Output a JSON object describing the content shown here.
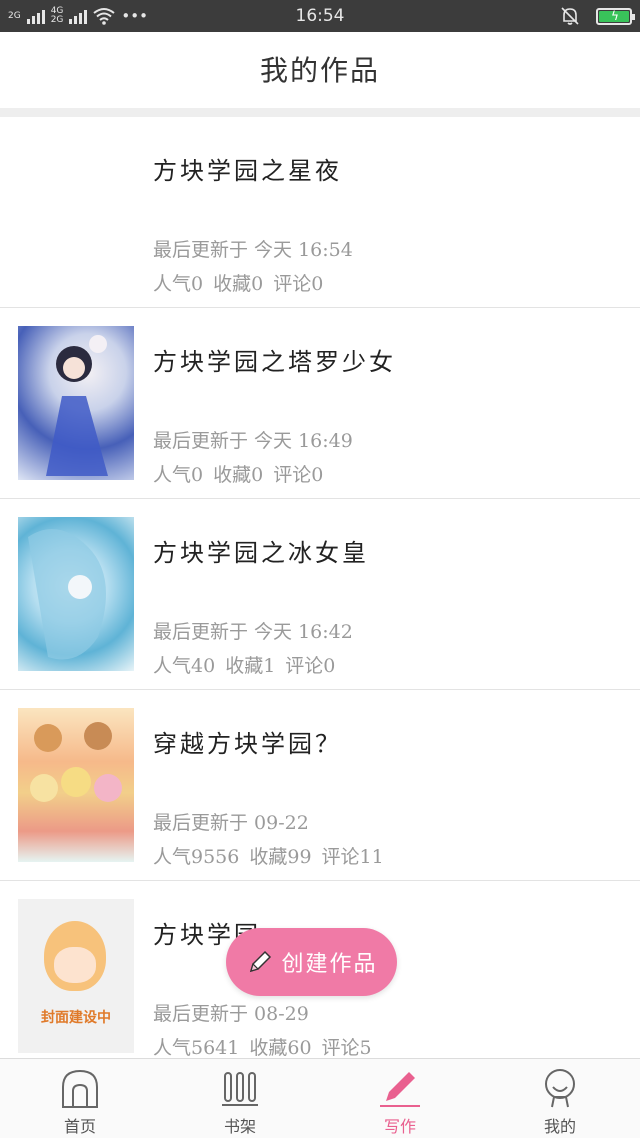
{
  "status_bar": {
    "left": [
      "2G",
      "4G",
      "2G",
      "•••"
    ],
    "time": "16:54",
    "icons": [
      "signal-icon",
      "wifi-icon",
      "bell-muted-icon",
      "battery-charging-icon"
    ]
  },
  "header": {
    "title": "我的作品"
  },
  "works": [
    {
      "title": "方块学园之星夜",
      "updated": "最后更新于 今天 16:54",
      "popularity": "人气0",
      "favorites": "收藏0",
      "comments": "评论0",
      "cover": "none"
    },
    {
      "title": "方块学园之塔罗少女",
      "updated": "最后更新于 今天 16:49",
      "popularity": "人气0",
      "favorites": "收藏0",
      "comments": "评论0",
      "cover": "anime-girl-blue-dress"
    },
    {
      "title": "方块学园之冰女皇",
      "updated": "最后更新于 今天 16:42",
      "popularity": "人气40",
      "favorites": "收藏1",
      "comments": "评论0",
      "cover": "anime-girl-ice"
    },
    {
      "title": "穿越方块学园？",
      "updated": "最后更新于 09-22",
      "popularity": "人气9556",
      "favorites": "收藏99",
      "comments": "评论11",
      "cover": "anime-group"
    },
    {
      "title": "方块学园",
      "updated": "最后更新于 08-29",
      "popularity": "人气5641",
      "favorites": "收藏60",
      "comments": "评论5",
      "cover": "cover-under-construction",
      "cover_caption": "封面建设中"
    }
  ],
  "fab": {
    "label": "创建作品",
    "color": "#f07aa6"
  },
  "bottom_nav": [
    {
      "label": "首页",
      "icon": "home-icon",
      "active": false
    },
    {
      "label": "书架",
      "icon": "bookshelf-icon",
      "active": false
    },
    {
      "label": "写作",
      "icon": "pen-icon",
      "active": true
    },
    {
      "label": "我的",
      "icon": "profile-icon",
      "active": false
    }
  ],
  "accent_color": "#e9608f"
}
